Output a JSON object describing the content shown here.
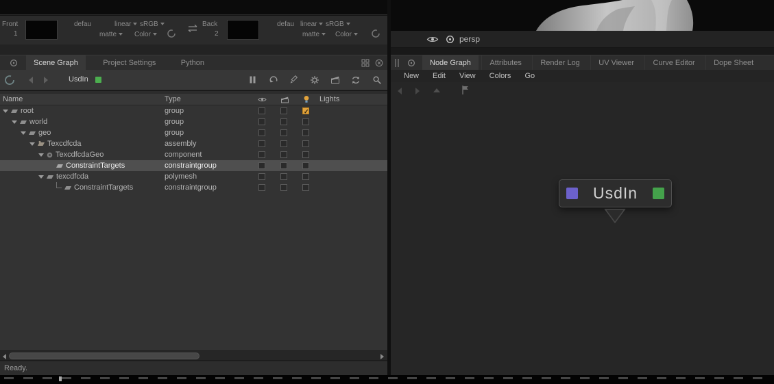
{
  "monitor": {
    "front": {
      "label": "Front",
      "number": "1",
      "colorspace": "defau",
      "view": "linear",
      "display": "sRGB",
      "matte": "matte",
      "channel": "Color"
    },
    "back": {
      "label": "Back",
      "number": "2",
      "colorspace": "defau",
      "view": "linear",
      "display": "sRGB",
      "matte": "matte",
      "channel": "Color"
    }
  },
  "viewport": {
    "camera": "persp"
  },
  "scene_graph": {
    "tabs": [
      {
        "label": "Scene Graph",
        "active": true
      },
      {
        "label": "Project Settings",
        "active": false
      },
      {
        "label": "Python",
        "active": false
      }
    ],
    "toolbar": {
      "node": "UsdIn"
    },
    "columns": {
      "name": "Name",
      "type": "Type",
      "lights": "Lights"
    },
    "rows": [
      {
        "name": "root",
        "type": "group",
        "depth": 0,
        "selected": false,
        "lights_on": true
      },
      {
        "name": "world",
        "type": "group",
        "depth": 1,
        "selected": false,
        "lights_on": false
      },
      {
        "name": "geo",
        "type": "group",
        "depth": 2,
        "selected": false,
        "lights_on": false
      },
      {
        "name": "Texcdfcda",
        "type": "assembly",
        "depth": 3,
        "selected": false,
        "lights_on": false
      },
      {
        "name": "TexcdfcdaGeo",
        "type": "component",
        "depth": 4,
        "selected": false,
        "lights_on": false
      },
      {
        "name": "ConstraintTargets",
        "type": "constraintgroup",
        "depth": 5,
        "selected": true,
        "lights_on": false
      },
      {
        "name": "texcdfcda",
        "type": "polymesh",
        "depth": 4,
        "selected": false,
        "lights_on": false
      },
      {
        "name": "ConstraintTargets",
        "type": "constraintgroup",
        "depth": 5,
        "selected": false,
        "lights_on": false
      }
    ],
    "status": "Ready."
  },
  "node_graph": {
    "tabs": [
      {
        "label": "Node Graph",
        "active": true
      },
      {
        "label": "Attributes",
        "active": false
      },
      {
        "label": "Render Log",
        "active": false
      },
      {
        "label": "UV Viewer",
        "active": false
      },
      {
        "label": "Curve Editor",
        "active": false
      },
      {
        "label": "Dope Sheet",
        "active": false
      }
    ],
    "menus": [
      "New",
      "Edit",
      "View",
      "Colors",
      "Go"
    ],
    "node": {
      "label": "UsdIn"
    }
  },
  "colors": {
    "node_left_port": "#6c61cb",
    "node_right_port": "#44a24b",
    "lights_check": "#e2a33c",
    "toolbar_badge_green": "#4cae4f"
  },
  "icons": {
    "eye": "eye-icon",
    "clapper": "clapper-icon",
    "light": "light-icon",
    "pause": "pause-icon",
    "undo": "undo-icon",
    "pencil": "pencil-icon",
    "gear": "gear-icon",
    "refresh": "refresh-icon",
    "search": "search-icon",
    "swirl": "swirl-icon",
    "swap": "swap-arrows-icon",
    "grid": "layout-grid-icon",
    "close": "close-icon",
    "flag": "flag-icon",
    "circle": "target-circle-icon",
    "handle": "drag-handle-icon"
  }
}
